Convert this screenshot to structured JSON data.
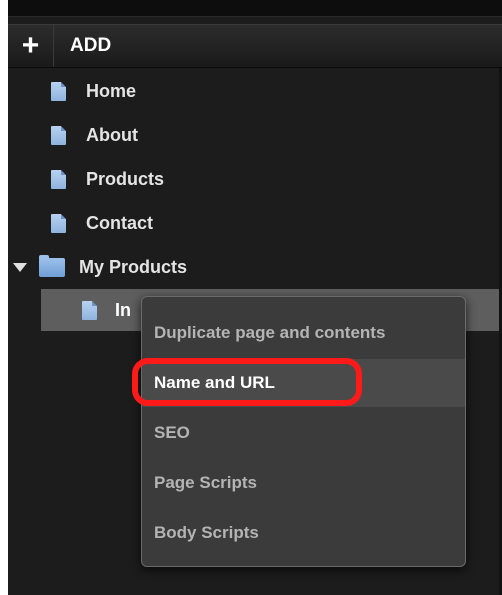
{
  "toolbar": {
    "add_icon": "plus-icon",
    "add_label": "ADD"
  },
  "tree": {
    "items": [
      {
        "label": "Home",
        "icon": "page-icon"
      },
      {
        "label": "About",
        "icon": "page-icon"
      },
      {
        "label": "Products",
        "icon": "page-icon"
      },
      {
        "label": "Contact",
        "icon": "page-icon"
      },
      {
        "label": "My Products",
        "icon": "folder-icon",
        "expanded": true
      }
    ],
    "child": {
      "label": "In",
      "icon": "page-icon",
      "selected": true
    }
  },
  "context_menu": {
    "items": [
      {
        "label": "Duplicate page and contents",
        "active": false
      },
      {
        "label": "Name and URL",
        "active": true
      },
      {
        "label": "SEO",
        "active": false
      },
      {
        "label": "Page Scripts",
        "active": false
      },
      {
        "label": "Body Scripts",
        "active": false
      }
    ]
  },
  "colors": {
    "highlight_ring": "#ff1a1a",
    "panel_bg": "#1c1c1c",
    "selected_row": "#5e5e5e",
    "menu_bg": "#3b3b3b"
  }
}
